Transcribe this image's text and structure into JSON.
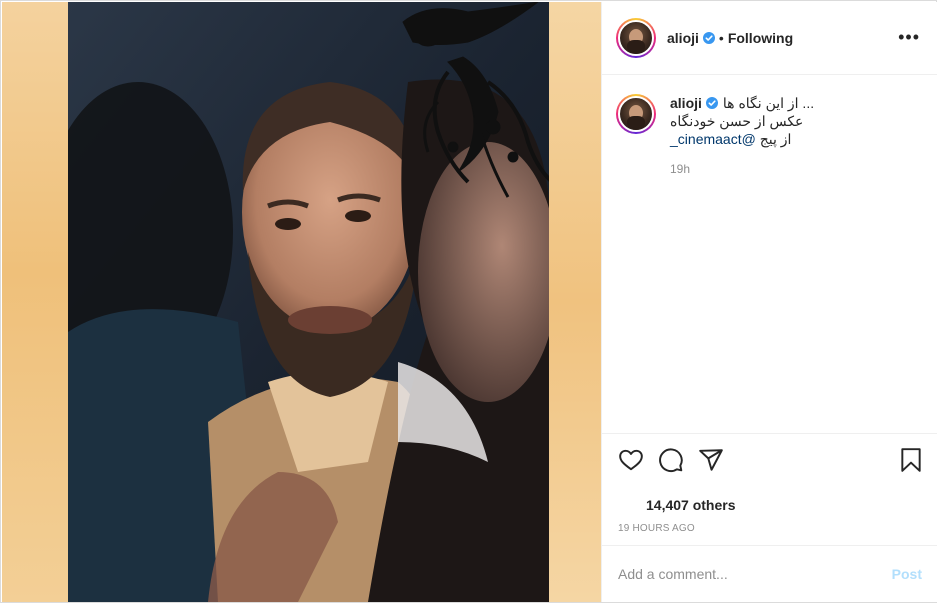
{
  "post": {
    "username": "alioji",
    "verified": true,
    "separator": "•",
    "follow_status": "Following",
    "more_icon": "more-options-icon"
  },
  "caption": {
    "username": "alioji",
    "line1": "... از این نگاه ها",
    "line2": "عکس از حسن خودنگاه",
    "line3_prefix": "از پیج ",
    "line3_mention": "@cinemaact_",
    "time": "19h"
  },
  "actions": {
    "like_icon": "heart-icon",
    "comment_icon": "comment-icon",
    "share_icon": "share-icon",
    "save_icon": "bookmark-icon"
  },
  "likes": {
    "text": "14,407 others"
  },
  "timestamp": "19 HOURS AGO",
  "comment": {
    "placeholder": "Add a comment...",
    "post_label": "Post"
  },
  "colors": {
    "accent_blue": "#0095f6",
    "post_disabled": "#b2dffc",
    "verified": "#3897f0",
    "frame_bg": "#f2c98a"
  }
}
